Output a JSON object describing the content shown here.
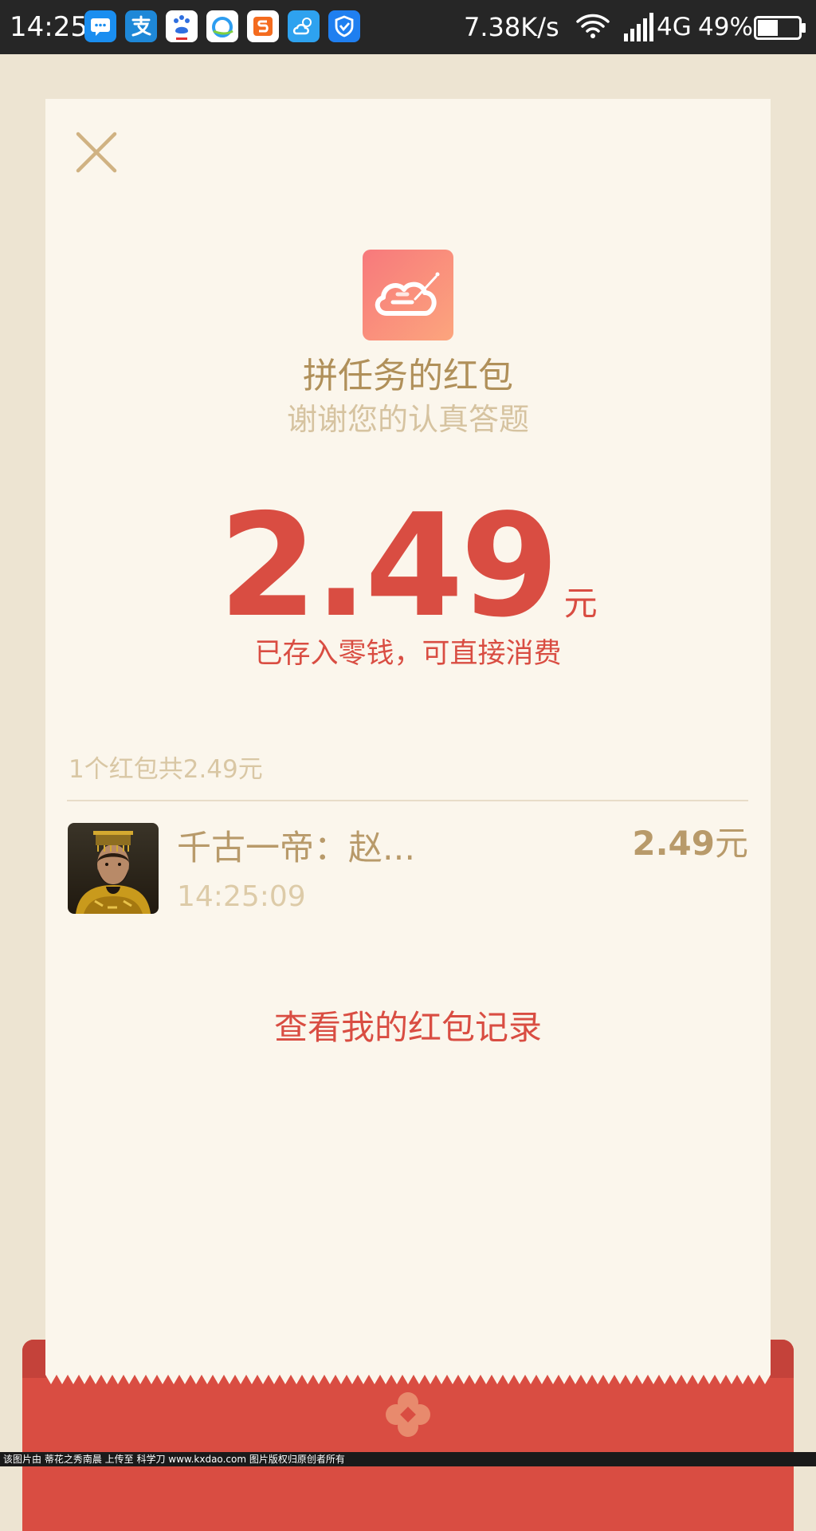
{
  "status_bar": {
    "time": "14:25",
    "notification_icons": [
      "message-icon",
      "alipay-icon",
      "baidu-icon",
      "browser-icon",
      "sogou-input-icon",
      "weather-icon",
      "security-shield-icon"
    ],
    "net_speed": "7.38K/s",
    "network_type": "4G",
    "battery_percent": "49%",
    "battery_level": 0.49
  },
  "header": {
    "title": "拼任务的红包",
    "subtitle": "谢谢您的认真答题"
  },
  "amount": {
    "value": "2.49",
    "unit": "元",
    "note": "已存入零钱，可直接消费"
  },
  "summary": {
    "text": "1个红包共2.49元"
  },
  "records": [
    {
      "name": "千古一帝：赵...",
      "time": "14:25:09",
      "amount": "2.49",
      "unit": "元"
    }
  ],
  "footer": {
    "history_link": "查看我的红包记录"
  },
  "watermark": "该图片由 蒂花之秀南晨 上传至 科学刀 www.kxdao.com 图片版权归原创者所有",
  "colors": {
    "primary_red": "#d94d42",
    "gold_text": "#b0905a",
    "card_bg": "#fbf6ec",
    "page_bg": "#ede4d2"
  }
}
